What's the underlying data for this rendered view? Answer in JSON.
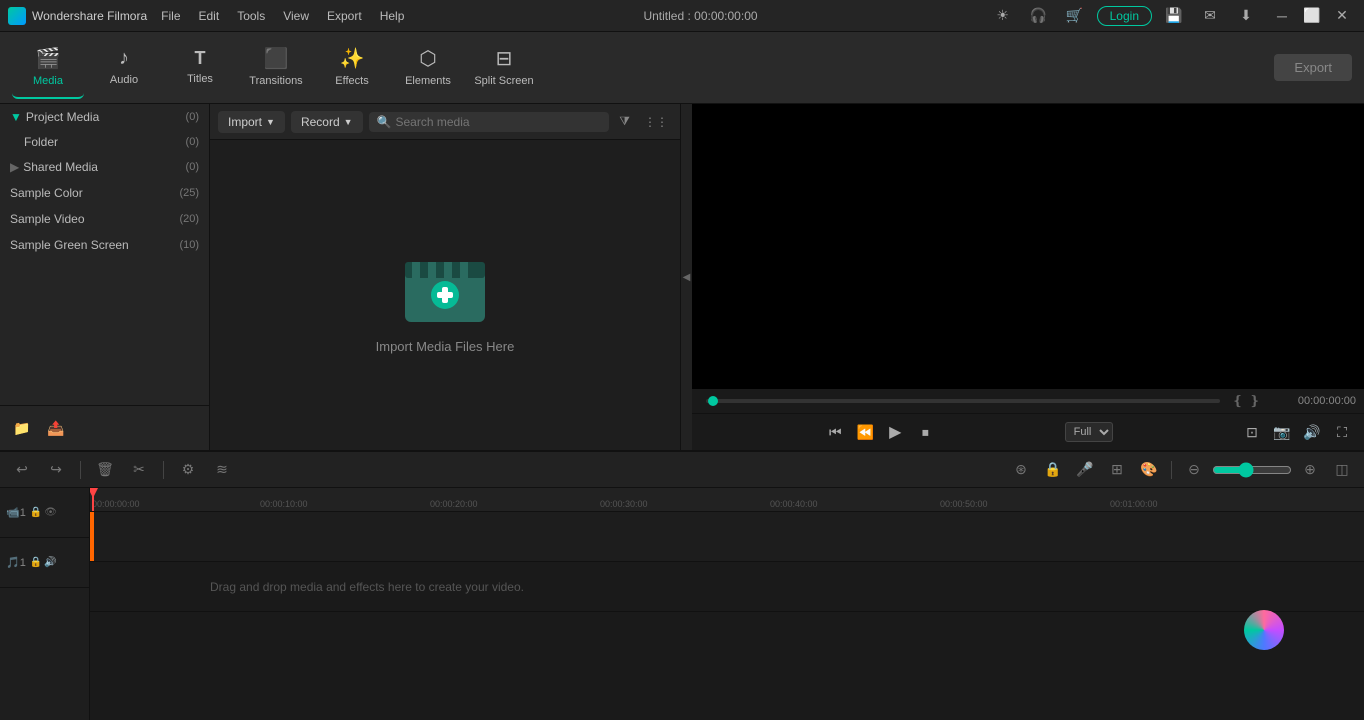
{
  "app": {
    "name": "Wondershare Filmora",
    "logo_alt": "filmora-logo"
  },
  "titlebar": {
    "title": "Untitled : 00:00:00:00",
    "menu": [
      "File",
      "Edit",
      "Tools",
      "View",
      "Export",
      "Help"
    ],
    "icons": [
      "sun-icon",
      "headphone-icon",
      "cart-icon",
      "login-icon",
      "save-icon",
      "mail-icon",
      "download-icon"
    ],
    "login_label": "Login",
    "win_controls": [
      "minimize",
      "maximize",
      "close"
    ]
  },
  "toolbar": {
    "items": [
      {
        "label": "Media",
        "icon": "🎬",
        "active": true
      },
      {
        "label": "Audio",
        "icon": "♪",
        "active": false
      },
      {
        "label": "Titles",
        "icon": "T",
        "active": false
      },
      {
        "label": "Transitions",
        "icon": "⬛",
        "active": false
      },
      {
        "label": "Effects",
        "icon": "✨",
        "active": false
      },
      {
        "label": "Elements",
        "icon": "⬡",
        "active": false
      },
      {
        "label": "Split Screen",
        "icon": "⊟",
        "active": false
      }
    ],
    "export_label": "Export"
  },
  "sidebar": {
    "sections": [
      {
        "label": "Project Media",
        "count": 0,
        "expanded": true,
        "children": [
          {
            "label": "Folder",
            "count": 0
          }
        ]
      },
      {
        "label": "Shared Media",
        "count": 0,
        "expanded": false,
        "children": []
      },
      {
        "label": "Sample Color",
        "count": 25,
        "expanded": false,
        "children": []
      },
      {
        "label": "Sample Video",
        "count": 20,
        "expanded": false,
        "children": []
      },
      {
        "label": "Sample Green Screen",
        "count": 10,
        "expanded": false,
        "children": []
      }
    ],
    "bottom_buttons": [
      "add-folder-icon",
      "import-icon"
    ]
  },
  "media_panel": {
    "import_label": "Import",
    "record_label": "Record",
    "search_placeholder": "Search media",
    "placeholder_text": "Import Media Files Here",
    "filter_icon": "filter-icon",
    "grid_icon": "grid-icon"
  },
  "preview": {
    "current_time": "00:00:00:00",
    "playback_speed": "Full",
    "controls": [
      "step-back",
      "frame-back",
      "play",
      "stop"
    ],
    "right_controls": [
      "fullscreen",
      "screenshot",
      "volume",
      "fit-screen"
    ]
  },
  "timeline": {
    "toolbar_buttons": [
      "undo",
      "redo",
      "delete",
      "cut",
      "settings",
      "waveform"
    ],
    "right_buttons": [
      "snap",
      "lock",
      "mic",
      "caption",
      "color-correct",
      "zoom-out",
      "zoom-in"
    ],
    "markers": [
      "00:00:00:00",
      "00:00:10:00",
      "00:00:20:00",
      "00:00:30:00",
      "00:00:40:00",
      "00:00:50:00",
      "00:01:00:00"
    ],
    "drag_drop_text": "Drag and drop media and effects here to create your video.",
    "tracks": [
      {
        "type": "video",
        "num": 1
      },
      {
        "type": "audio",
        "num": 1
      }
    ]
  }
}
